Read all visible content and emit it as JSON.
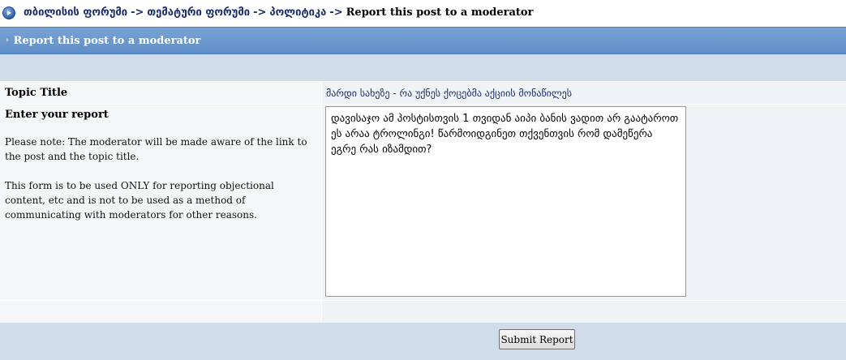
{
  "breadcrumb": {
    "items": [
      "თბილისის ფორუმი",
      "თემატური ფორუმი",
      "პოლიტიკა"
    ],
    "separator": "->",
    "current": "Report this post to a moderator"
  },
  "header": {
    "title": "Report this post to a moderator"
  },
  "form": {
    "topic_label": "Topic Title",
    "topic_value": "მარდი სახეზე - რა უქნეს ქოცებმა აქციის მონაწილეს",
    "report_label": "Enter your report",
    "note_1": "Please note: The moderator will be made aware of the link to the post and the topic title.",
    "note_2": "This form is to be used ONLY for reporting objectional content, etc and is not to be used as a method of communicating with moderators for other reasons.",
    "report_text": "დავისაჯო ამ პოსტისთვის 1 თვიდან აიპი ბანის ვადით არ გაატაროთ ეს არაა ტროლინგი! წარმოიდგინეთ თქვენთვის რომ დამეწერა ეგრე რას იზამდით?",
    "submit_label": "Submit Report"
  },
  "colors": {
    "header_blue": "#6b98cc",
    "band_blue": "#d1dcea",
    "link_navy": "#1a2e6b"
  },
  "icons": {
    "nav": "circle-arrow-icon",
    "header": "small-arrow-icon"
  }
}
